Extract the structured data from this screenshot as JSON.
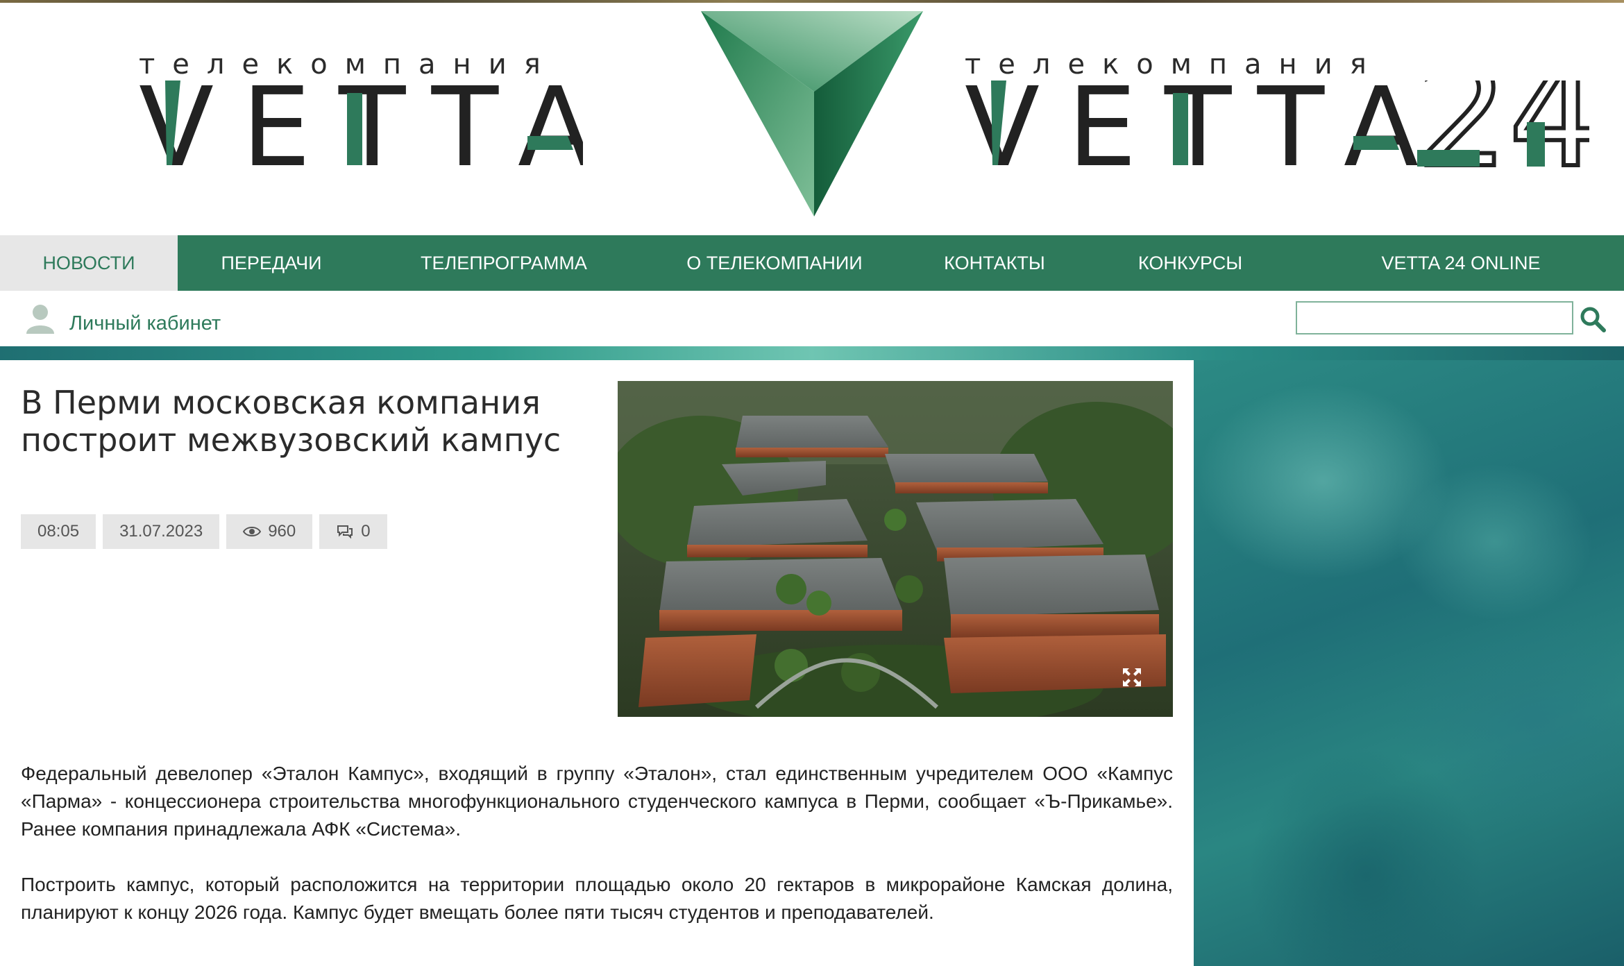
{
  "brand": {
    "left_subtitle": "телекомпания",
    "left_name": "VETTA",
    "right_subtitle": "телекомпания",
    "right_name": "VETTA",
    "right_suffix": "24"
  },
  "colors": {
    "accent_green": "#2e7a5b",
    "dark_text": "#2b2b2b",
    "chip_bg": "#e6e6e6"
  },
  "nav": {
    "items": [
      {
        "label": "НОВОСТИ",
        "active": true
      },
      {
        "label": "ПЕРЕДАЧИ",
        "active": false
      },
      {
        "label": "ТЕЛЕПРОГРАММА",
        "active": false
      },
      {
        "label": "О ТЕЛЕКОМПАНИИ",
        "active": false
      },
      {
        "label": "КОНТАКТЫ",
        "active": false
      },
      {
        "label": "КОНКУРСЫ",
        "active": false
      },
      {
        "label": "VETTA 24 ONLINE",
        "active": false
      }
    ]
  },
  "subbar": {
    "cabinet_label": "Личный кабинет",
    "cabinet_icon": "user-icon",
    "search_value": "",
    "search_icon": "search-icon"
  },
  "article": {
    "title": "В Перми московская компания построит межвузовский кампус",
    "time": "08:05",
    "date": "31.07.2023",
    "views": "960",
    "views_icon": "eye-icon",
    "comments": "0",
    "comments_icon": "comments-icon",
    "photo_icon": "expand-icon",
    "paragraphs": [
      "Федеральный девелопер «Эталон Кампус», входящий в группу «Эталон», стал единственным учредителем ООО «Кампус «Парма» - концессионера строительства многофункционального студенческого кампуса в Перми, сообщает «Ъ-Прикамье». Ранее компания принадлежала АФК «Система».",
      "Построить кампус, который расположится на территории площадью около 20 гектаров в микрорайоне Камская долина, планируют к концу 2026 года. Кампус будет вмещать более пяти тысяч студентов и преподавателей."
    ]
  }
}
